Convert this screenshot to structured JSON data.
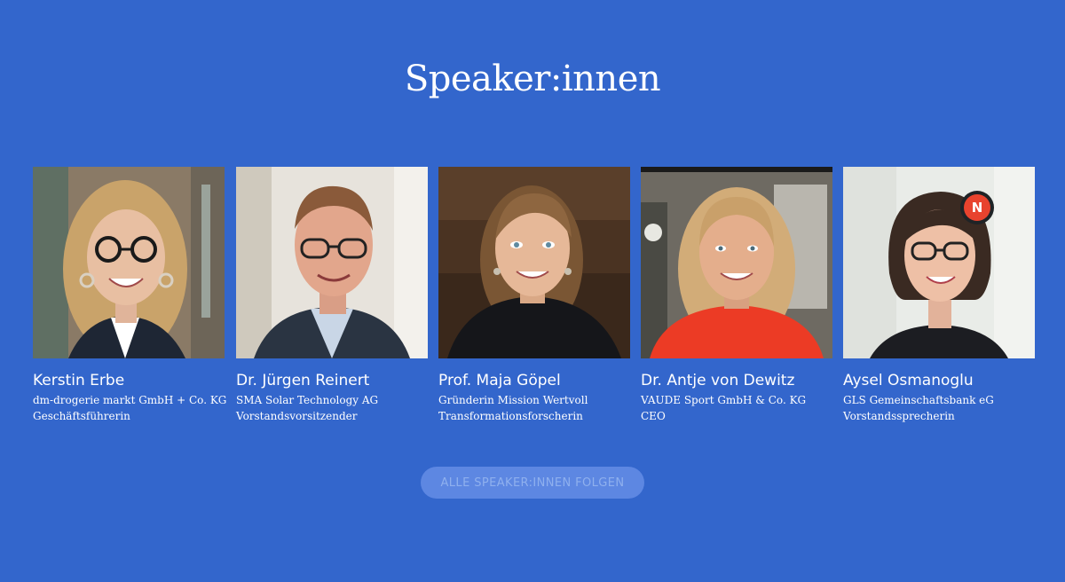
{
  "section": {
    "title": "Speaker:innen"
  },
  "speakers": [
    {
      "name": "Kerstin Erbe",
      "line1": "dm-drogerie markt GmbH + Co. KG",
      "line2": "Geschäftsführerin"
    },
    {
      "name": "Dr. Jürgen Reinert",
      "line1": "SMA Solar Technology AG",
      "line2": "Vorstandsvorsitzender"
    },
    {
      "name": "Prof. Maja Göpel",
      "line1": "Gründerin Mission Wertvoll",
      "line2": "Transformationsforscherin"
    },
    {
      "name": "Dr. Antje von Dewitz",
      "line1": "VAUDE Sport GmbH & Co. KG",
      "line2": "CEO"
    },
    {
      "name": "Aysel Osmanoglu",
      "line1": "GLS Gemeinschaftsbank eG",
      "line2": "Vorstandssprecherin",
      "badge": "N"
    }
  ],
  "cta": {
    "label": "ALLE SPEAKER:INNEN FOLGEN"
  },
  "colors": {
    "background": "#3366cc",
    "button": "#5d87e2",
    "badge": "#e8432e"
  }
}
